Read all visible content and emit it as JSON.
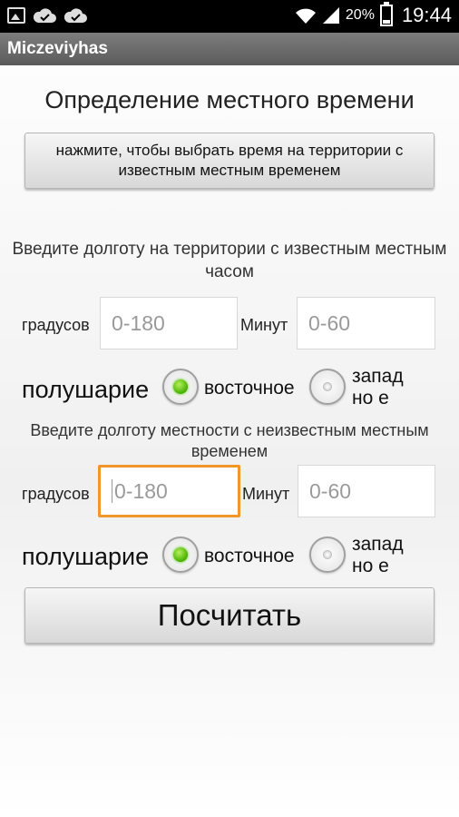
{
  "status_bar": {
    "icons_left": [
      "image-icon",
      "cloud-check-icon",
      "cloud-check-icon"
    ],
    "battery": "20%",
    "time": "19:44"
  },
  "app": {
    "title": "Miczeviyhas"
  },
  "heading": "Определение местного времени",
  "pick_button": "нажмите, чтобы выбрать время на территории с известным местным временем",
  "known": {
    "prompt": "Введите долготу на территории с известным местным часом",
    "degrees_label": "градусов",
    "degrees_placeholder": "0-180",
    "minutes_label": "Минут",
    "minutes_placeholder": "0-60",
    "hemisphere_label": "полушарие",
    "east_label": "восточное",
    "west_label": "западно е",
    "selected": "east"
  },
  "unknown": {
    "prompt": "Введите долготу местности с неизвестным местным временем",
    "degrees_label": "градусов",
    "degrees_placeholder": "0-180",
    "minutes_label": "Минут",
    "minutes_placeholder": "0-60",
    "hemisphere_label": "полушарие",
    "east_label": "восточное",
    "west_label": "западно е",
    "selected": "east"
  },
  "calculate_button": "Посчитать",
  "colors": {
    "focus": "#f0962a",
    "radio_on": "#45b000",
    "titlebar": "#6a6a6a"
  }
}
